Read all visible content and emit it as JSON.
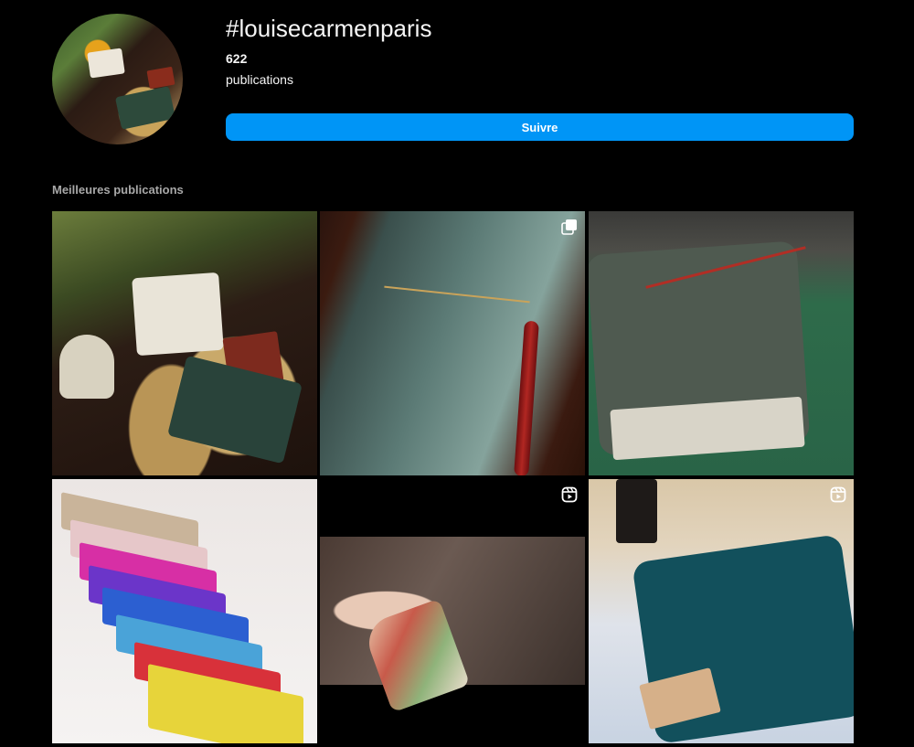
{
  "header": {
    "hashtag": "#louisecarmenparis",
    "post_count": "622",
    "post_count_label": "publications",
    "follow_label": "Suivre"
  },
  "top_posts": {
    "title": "Meilleures publications",
    "items": [
      {
        "type": "photo",
        "badge_icon": ""
      },
      {
        "type": "carousel",
        "badge_icon": "carousel-icon"
      },
      {
        "type": "photo",
        "badge_icon": ""
      },
      {
        "type": "photo",
        "badge_icon": ""
      },
      {
        "type": "reel",
        "badge_icon": "reel-icon"
      },
      {
        "type": "reel",
        "badge_icon": "reel-icon"
      }
    ]
  },
  "colors": {
    "background": "#000000",
    "text": "#f5f5f5",
    "muted_text": "#a8a8a8",
    "accent": "#0095f6"
  }
}
